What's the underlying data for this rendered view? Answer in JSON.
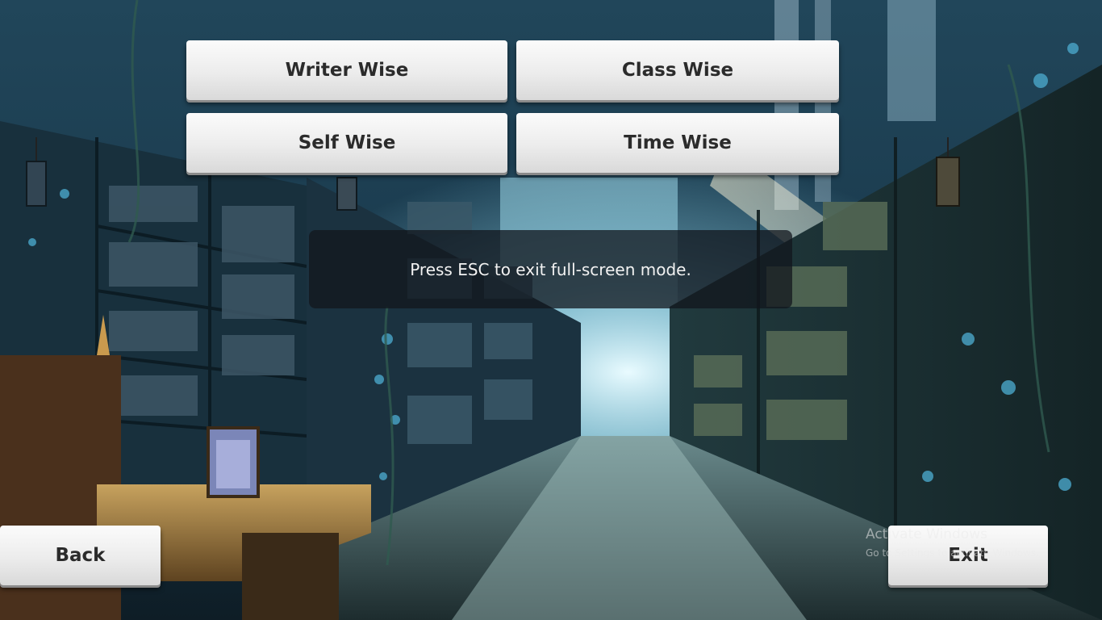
{
  "menu": {
    "writer_wise": "Writer Wise",
    "class_wise": "Class Wise",
    "self_wise": "Self Wise",
    "time_wise": "Time Wise"
  },
  "nav": {
    "back": "Back",
    "exit": "Exit"
  },
  "fullscreen_notice": "Press ESC to exit full-screen mode.",
  "watermark": {
    "title": "Activate Windows",
    "subtitle": "Go to Settings to activate Windows."
  },
  "colors": {
    "button_text": "#2b2b2b",
    "toast_bg": "#12161c"
  }
}
